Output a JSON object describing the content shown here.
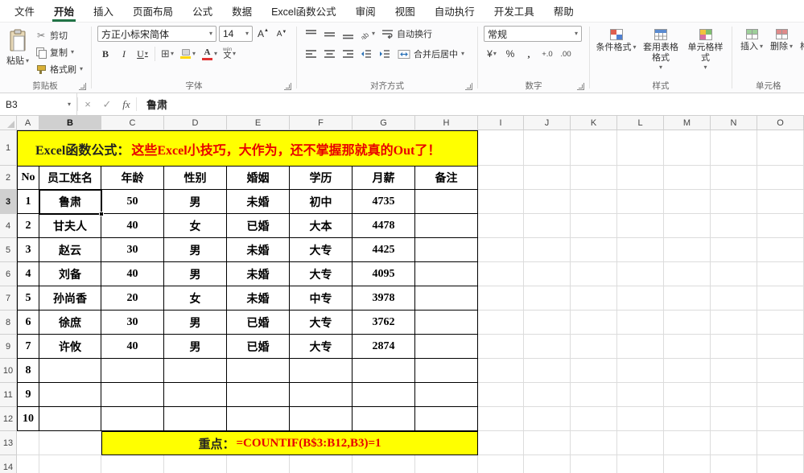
{
  "menu": {
    "tabs": [
      {
        "id": "file",
        "label": "文件"
      },
      {
        "id": "home",
        "label": "开始",
        "active": true
      },
      {
        "id": "insert",
        "label": "插入"
      },
      {
        "id": "page-layout",
        "label": "页面布局"
      },
      {
        "id": "formulas",
        "label": "公式"
      },
      {
        "id": "data",
        "label": "数据"
      },
      {
        "id": "excel-functions",
        "label": "Excel函数公式"
      },
      {
        "id": "review",
        "label": "审阅"
      },
      {
        "id": "view",
        "label": "视图"
      },
      {
        "id": "automate",
        "label": "自动执行"
      },
      {
        "id": "developer",
        "label": "开发工具"
      },
      {
        "id": "help",
        "label": "帮助"
      }
    ]
  },
  "ribbon": {
    "clipboard": {
      "label": "剪贴板",
      "paste": "粘贴",
      "cut": "剪切",
      "copy": "复制",
      "painter": "格式刷"
    },
    "font": {
      "label": "字体",
      "name": "方正小标宋简体",
      "size": "14",
      "bold": "B",
      "italic": "I",
      "underline": "U",
      "phonetic_top": "wén",
      "phonetic": "文"
    },
    "alignment": {
      "label": "对齐方式",
      "wrap": "自动换行",
      "merge": "合并后居中"
    },
    "number": {
      "label": "数字",
      "format": "常规",
      "currency": "¥",
      "percent": "%",
      "comma": ",",
      "inc_decimal": "+.0",
      "dec_decimal": ".00"
    },
    "styles": {
      "label": "样式",
      "conditional": "条件格式",
      "table": "套用表格格式",
      "cell": "单元格样式"
    },
    "cells": {
      "label": "单元格",
      "insert": "插入",
      "delete": "删除",
      "format": "格式"
    }
  },
  "formula_bar": {
    "name_box": "B3",
    "value": "鲁肃",
    "fx": "fx"
  },
  "sheet": {
    "columns": [
      "A",
      "B",
      "C",
      "D",
      "E",
      "F",
      "G",
      "H",
      "I",
      "J",
      "K",
      "L",
      "M",
      "N",
      "O"
    ],
    "visible_rows": 14,
    "selected": {
      "cell": "B3",
      "column": "B",
      "row": 3
    },
    "banner": {
      "label": "Excel函数公式：",
      "text": "这些Excel小技巧，大作为，还不掌握那就真的Out了！"
    },
    "table": {
      "headers": [
        "No",
        "员工姓名",
        "年龄",
        "性别",
        "婚姻",
        "学历",
        "月薪",
        "备注"
      ],
      "rows": [
        [
          "1",
          "鲁肃",
          "50",
          "男",
          "未婚",
          "初中",
          "4735",
          ""
        ],
        [
          "2",
          "甘夫人",
          "40",
          "女",
          "已婚",
          "大本",
          "4478",
          ""
        ],
        [
          "3",
          "赵云",
          "30",
          "男",
          "未婚",
          "大专",
          "4425",
          ""
        ],
        [
          "4",
          "刘备",
          "40",
          "男",
          "未婚",
          "大专",
          "4095",
          ""
        ],
        [
          "5",
          "孙尚香",
          "20",
          "女",
          "未婚",
          "中专",
          "3978",
          ""
        ],
        [
          "6",
          "徐庶",
          "30",
          "男",
          "已婚",
          "大专",
          "3762",
          ""
        ],
        [
          "7",
          "许攸",
          "40",
          "男",
          "已婚",
          "大专",
          "2874",
          ""
        ],
        [
          "8",
          "",
          "",
          "",
          "",
          "",
          "",
          ""
        ],
        [
          "9",
          "",
          "",
          "",
          "",
          "",
          "",
          ""
        ],
        [
          "10",
          "",
          "",
          "",
          "",
          "",
          "",
          ""
        ]
      ]
    },
    "footer": {
      "label": "重点：",
      "formula": "=COUNTIF(B$3:B12,B3)=1"
    },
    "accent_colors": {
      "banner_bg": "#ffff00",
      "highlight_text": "#e80000",
      "table_border": "#000000"
    }
  }
}
